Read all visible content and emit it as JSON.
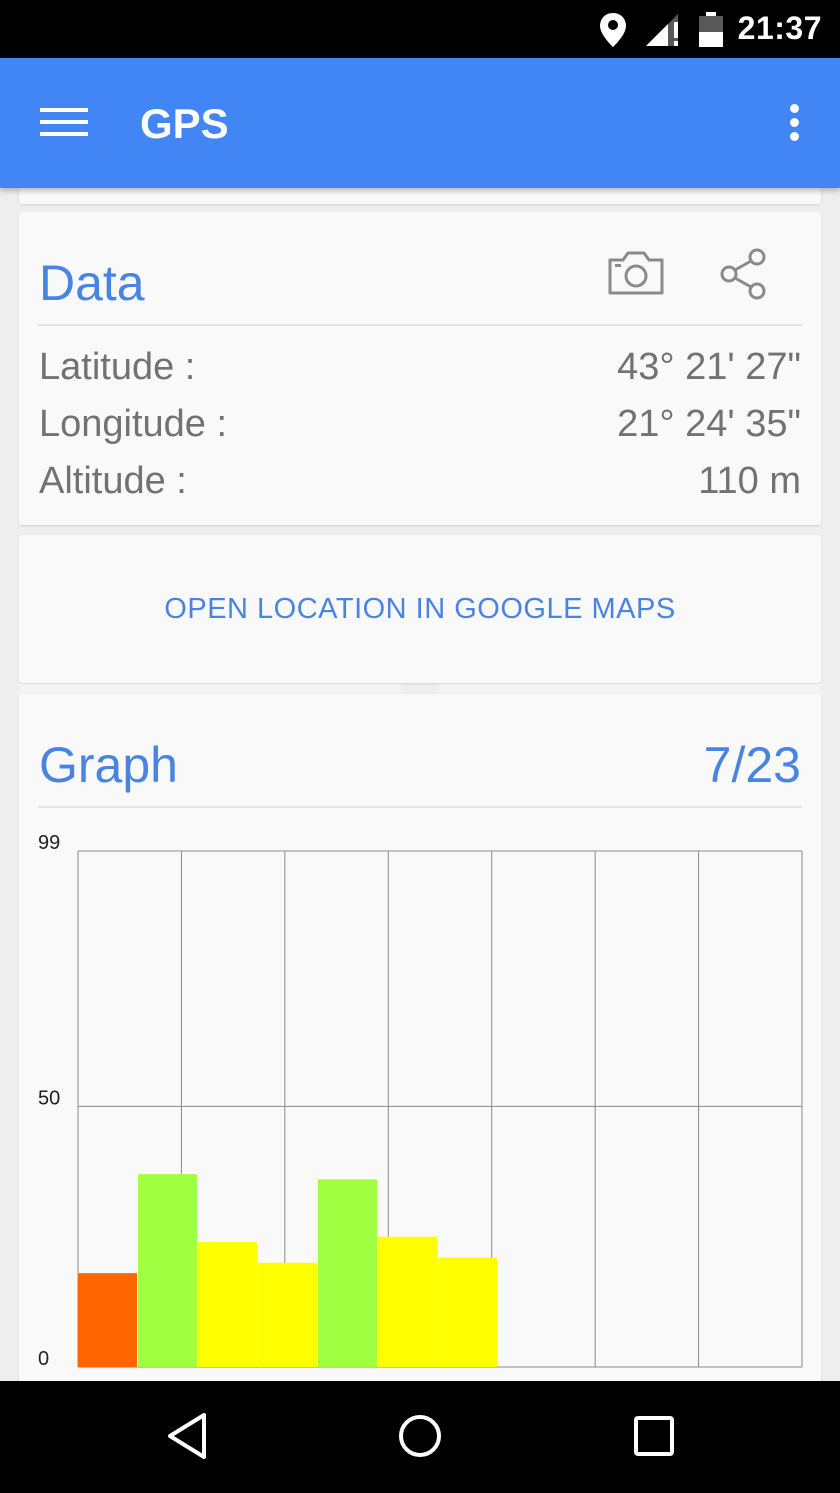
{
  "status_bar": {
    "time": "21:37",
    "icons": [
      "location-icon",
      "signal-icon",
      "battery-icon"
    ]
  },
  "app_bar": {
    "title": "GPS",
    "menu_icon": "hamburger-menu-icon",
    "overflow_icon": "more-vert-icon"
  },
  "data_card": {
    "heading": "Data",
    "actions": [
      "camera-icon",
      "share-icon"
    ],
    "rows": [
      {
        "label": "Latitude :",
        "value": "43° 21' 27\""
      },
      {
        "label": "Longitude :",
        "value": "21° 24' 35\""
      },
      {
        "label": "Altitude :",
        "value": "110 m"
      }
    ]
  },
  "maps_card": {
    "link_label": "OPEN LOCATION IN GOOGLE MAPS"
  },
  "graph_card": {
    "heading": "Graph",
    "counter": "7/23"
  },
  "chart_data": {
    "type": "bar",
    "title": "",
    "xlabel": "",
    "ylabel": "",
    "ylim": [
      0,
      99
    ],
    "y_tick_labels": [
      "99",
      "50",
      "0"
    ],
    "y_ticks": [
      99,
      50,
      0
    ],
    "x_gridlines": 7,
    "grid": true,
    "bars": [
      {
        "value": 18,
        "color": "#ff6600"
      },
      {
        "value": 37,
        "color": "#a0ff40"
      },
      {
        "value": 24,
        "color": "#ffff00"
      },
      {
        "value": 20,
        "color": "#ffff00"
      },
      {
        "value": 36,
        "color": "#a0ff40"
      },
      {
        "value": 25,
        "color": "#ffff00"
      },
      {
        "value": 21,
        "color": "#ffff00"
      }
    ],
    "colors": {
      "weak": "#ff6600",
      "medium": "#ffff00",
      "strong": "#a0ff40"
    }
  },
  "nav_bar": {
    "buttons": [
      "back-icon",
      "home-icon",
      "recents-icon"
    ]
  }
}
